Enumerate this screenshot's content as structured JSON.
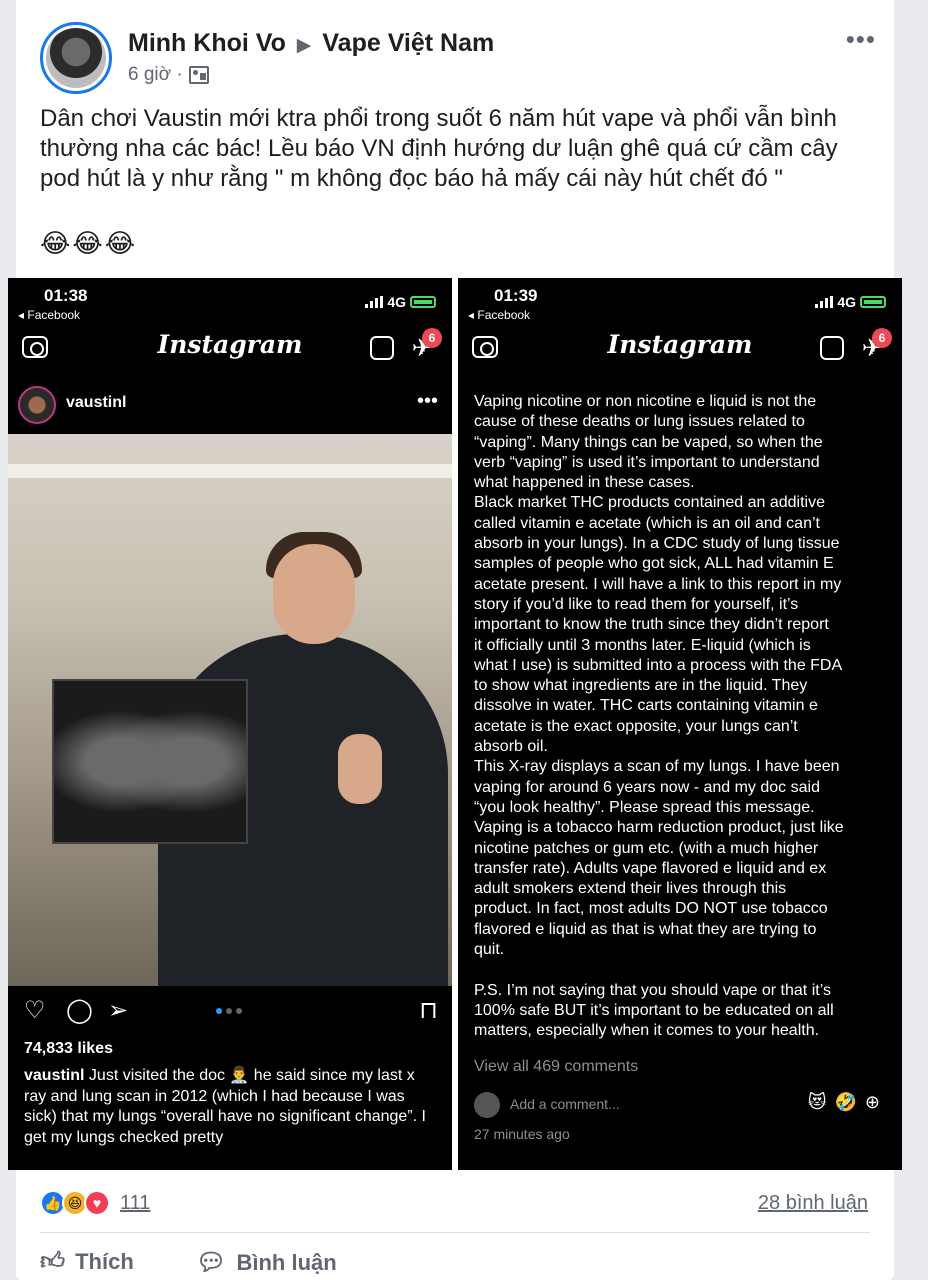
{
  "post": {
    "author": "Minh Khoi Vo",
    "arrow": "▶",
    "group": "Vape Việt Nam",
    "time": "6 giờ ·",
    "text": "Dân chơi Vaustin mới ktra phổi trong suốt 6 năm hút vape và phổi vẫn bình thường nha các bác! Lều báo VN định hướng dư luận ghê quá cứ cầm cây pod hút là y như rằng \" m không đọc báo hả mấy cái này hút chết đó \"",
    "emojis": "😂😂😂"
  },
  "left_screenshot": {
    "time": "01:38",
    "back": "◂ Facebook",
    "network": "4G",
    "logo": "Instagram",
    "badge": "6",
    "username": "vaustinl",
    "likes": "74,833 likes",
    "caption_user": "vaustinl",
    "caption": " Just visited the doc 👨‍⚕️ he said since my last x ray and lung scan in 2012 (which I had because I was sick) that my lungs “overall have no significant change”. I get my lungs checked pretty"
  },
  "right_screenshot": {
    "time": "01:39",
    "back": "◂ Facebook",
    "network": "4G",
    "logo": "Instagram",
    "badge": "6",
    "body": "Vaping nicotine or non nicotine e liquid is not the\ncause of these deaths or lung issues related to\n“vaping”. Many things can be vaped, so when the\nverb “vaping” is used it’s important to understand\nwhat happened in these cases.\nBlack market THC products contained an additive\ncalled vitamin e acetate (which is an oil and can’t\nabsorb in your lungs). In a CDC study of lung tissue\nsamples of people who got sick, ALL had vitamin E\nacetate present. I will have a link to this report in my\nstory if you’d like to read them for yourself, it’s\nimportant to know the truth since they didn’t report\nit officially until 3 months later. E-liquid (which is\nwhat I use) is submitted into a process with the FDA\nto show what ingredients are in the liquid. They\ndissolve in water. THC carts containing vitamin e\nacetate is the exact opposite, your lungs can’t\nabsorb oil.\nThis X-ray displays a scan of my lungs. I have been\nvaping for around 6 years now - and my doc said\n“you look healthy”. Please spread this message.\nVaping is a tobacco harm reduction product, just like\nnicotine patches or gum etc. (with a much higher\ntransfer rate). Adults vape flavored e liquid and ex\nadult smokers extend their lives through this\nproduct. In fact, most adults DO NOT use tobacco\nflavored e liquid as that is what they are trying to\nquit.\n\nP.S. I’m not saying that you should vape or that it’s\n100% safe BUT it’s important to be educated on all\nmatters, especially when it comes to your health.",
    "view_all": "View all 469 comments",
    "add_comment": "Add a comment...",
    "comment_emojis": "😻🤣⊕",
    "ago": "27 minutes ago"
  },
  "footer": {
    "reaction_count": "111",
    "comment_count": "28 bình luận",
    "like_label": "Thích",
    "comment_label": "Bình luận"
  },
  "colors": {
    "accent": "#1877f2",
    "ig_badge": "#ed4956",
    "battery": "#4cd964"
  }
}
